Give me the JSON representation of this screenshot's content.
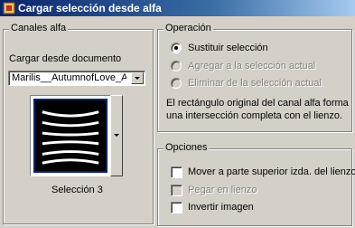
{
  "window": {
    "title": "Cargar selección desde alfa"
  },
  "canales": {
    "legend": "Canales alfa",
    "doc_label": "Cargar desde documento",
    "doc_value": "Marilis__AutumnofLove_Al",
    "selection_label": "Selección 3"
  },
  "operacion": {
    "legend": "Operación",
    "options": [
      {
        "label": "Sustituir selección",
        "selected": true,
        "enabled": true
      },
      {
        "label": "Agregar a la selección actual",
        "selected": false,
        "enabled": false
      },
      {
        "label": "Eliminar de la selección actual",
        "selected": false,
        "enabled": false
      }
    ],
    "description_line1": "El rectángulo original del canal alfa forma",
    "description_line2": "una intersección completa con el lienzo."
  },
  "opciones": {
    "legend": "Opciones",
    "items": [
      {
        "label": "Mover a parte superior izda. del lienzo",
        "checked": false,
        "enabled": true
      },
      {
        "label": "Pegar en lienzo",
        "checked": false,
        "enabled": false
      },
      {
        "label": "Invertir imagen",
        "checked": false,
        "enabled": true
      }
    ]
  },
  "colors": {
    "title_bar": "#0a246a",
    "dialog_bg": "#d4d0c8",
    "disabled_text": "#808080"
  }
}
